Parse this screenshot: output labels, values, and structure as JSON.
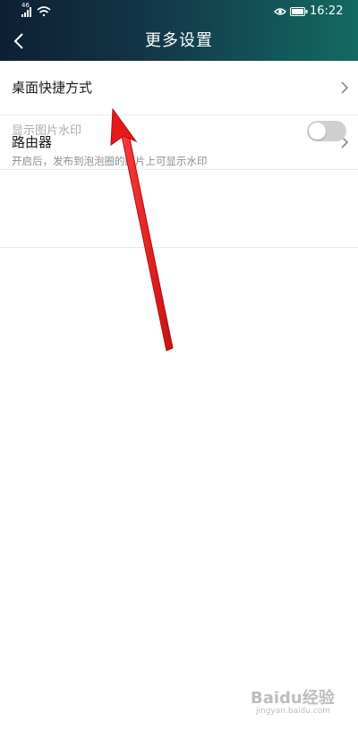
{
  "status_bar": {
    "network_label": "46",
    "time": "16:22",
    "icons": [
      "signal-icon",
      "wifi-icon",
      "eye-icon",
      "battery-icon"
    ]
  },
  "header": {
    "title": "更多设置",
    "back_icon": "chevron-left-icon"
  },
  "settings": {
    "items": [
      {
        "label": "桌面快捷方式",
        "icon": "chevron-right-icon"
      },
      {
        "label": "路由器",
        "icon": "chevron-right-icon"
      }
    ],
    "watermark_toggle": {
      "label": "显示图片水印",
      "description": "开启后，发布到泡泡圈的图片上可显示水印",
      "state": "off"
    }
  },
  "annotation": {
    "arrow_color": "#e8191b"
  },
  "watermark": {
    "brand": "Baidu经验",
    "url": "jingyan.baidu.com"
  },
  "colors": {
    "header_gradient_start": "#0e1f33",
    "header_gradient_end": "#136a63",
    "toggle_off": "#cfcfcf"
  }
}
